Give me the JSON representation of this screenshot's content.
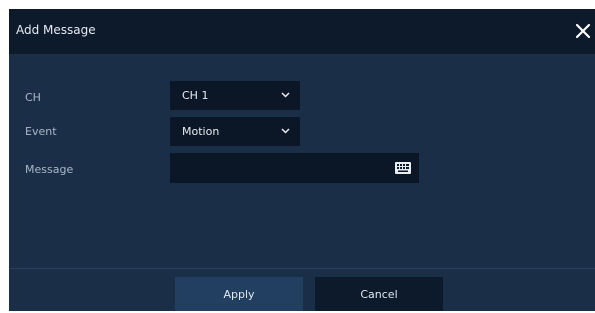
{
  "dialog": {
    "title": "Add Message",
    "close_icon": "close-icon"
  },
  "form": {
    "channel": {
      "label": "CH",
      "value": "CH 1",
      "icon": "chevron-down-icon"
    },
    "event": {
      "label": "Event",
      "value": "Motion",
      "icon": "chevron-down-icon"
    },
    "message": {
      "label": "Message",
      "value": "",
      "icon": "keyboard-icon"
    }
  },
  "footer": {
    "apply_label": "Apply",
    "cancel_label": "Cancel"
  },
  "colors": {
    "panel": "#1a2e48",
    "titlebar": "#0c1a2c",
    "field": "#0b1726",
    "apply_button": "#223f62",
    "label_text": "#a9b8c8"
  }
}
